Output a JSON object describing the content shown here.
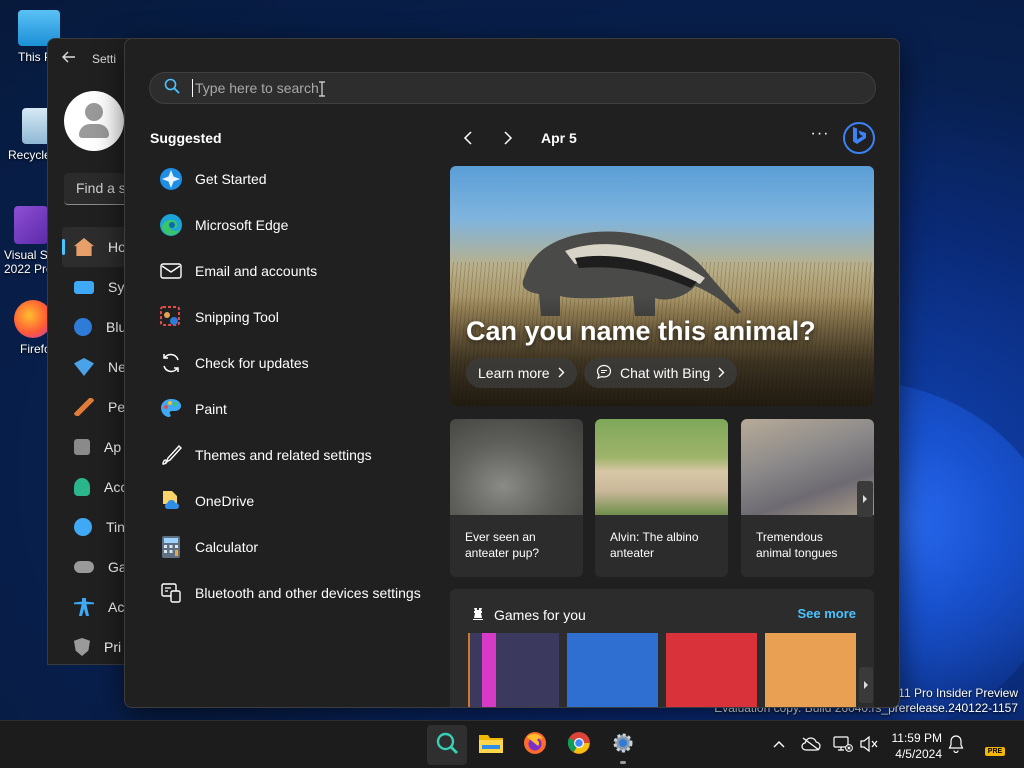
{
  "desktop": {
    "icons": [
      {
        "label": "This P",
        "icon": "this-pc-icon"
      },
      {
        "label": "Recycle",
        "icon": "recycle-bin-icon"
      },
      {
        "label": "Visual St\n2022 Pre",
        "icon": "visual-studio-icon"
      },
      {
        "label": "Firefo",
        "icon": "firefox-icon"
      }
    ],
    "watermark_line1": "s 11 Pro Insider Preview",
    "watermark_line2": "Evaluation copy. Build 26040.rs_prerelease.240122-1157"
  },
  "settings": {
    "title": "Setti",
    "find_placeholder": "Find a se",
    "nav": [
      {
        "label": "Ho",
        "icon": "home-icon",
        "color": "#e8a06a"
      },
      {
        "label": "Sys",
        "icon": "system-icon",
        "color": "#3fa9f5"
      },
      {
        "label": "Blu",
        "icon": "bluetooth-icon",
        "color": "#2f7bd8"
      },
      {
        "label": "Ne",
        "icon": "network-icon",
        "color": "#4aa3e8"
      },
      {
        "label": "Per",
        "icon": "personalization-icon",
        "color": "#e07b39"
      },
      {
        "label": "Ap",
        "icon": "apps-icon",
        "color": "#8a8a8a"
      },
      {
        "label": "Acc",
        "icon": "accounts-icon",
        "color": "#2bb58a"
      },
      {
        "label": "Tin",
        "icon": "time-icon",
        "color": "#3fa9f5"
      },
      {
        "label": "Ga",
        "icon": "gaming-icon",
        "color": "#9a9a9a"
      },
      {
        "label": "Acc",
        "icon": "accessibility-icon",
        "color": "#3fa9f5"
      },
      {
        "label": "Pri",
        "icon": "privacy-icon",
        "color": "#9a9a9a"
      }
    ]
  },
  "search": {
    "placeholder": "Type here to search",
    "suggested_title": "Suggested",
    "suggested": [
      {
        "label": "Get Started",
        "icon": "get-started-icon"
      },
      {
        "label": "Microsoft Edge",
        "icon": "edge-icon"
      },
      {
        "label": "Email and accounts",
        "icon": "mail-icon"
      },
      {
        "label": "Snipping Tool",
        "icon": "snipping-tool-icon"
      },
      {
        "label": "Check for updates",
        "icon": "refresh-icon"
      },
      {
        "label": "Paint",
        "icon": "paint-icon"
      },
      {
        "label": "Themes and related settings",
        "icon": "brush-icon"
      },
      {
        "label": "OneDrive",
        "icon": "onedrive-icon"
      },
      {
        "label": "Calculator",
        "icon": "calculator-icon"
      },
      {
        "label": "Bluetooth and other devices settings",
        "icon": "devices-icon"
      }
    ],
    "date": "Apr 5",
    "more_label": "···",
    "hero": {
      "title": "Can you name this animal?",
      "learn_more": "Learn more",
      "chat_with_bing": "Chat with Bing"
    },
    "cards": [
      {
        "caption": "Ever seen an anteater pup?",
        "color": "#6f6f6a"
      },
      {
        "caption": "Alvin: The albino anteater",
        "color": "#c9b79a"
      },
      {
        "caption": "Tremendous animal tongues",
        "color": "#8c8a8a"
      }
    ],
    "games": {
      "title": "Games for you",
      "see_more": "See more",
      "tiles": [
        "#3b3a5e",
        "#2f6fd1",
        "#d9323a",
        "#e9a052"
      ]
    }
  },
  "taskbar": {
    "apps": [
      "search-icon",
      "file-explorer-icon",
      "firefox-icon",
      "chrome-icon",
      "settings-icon"
    ],
    "time": "11:59 PM",
    "date": "4/5/2024",
    "badge": "PRE"
  }
}
